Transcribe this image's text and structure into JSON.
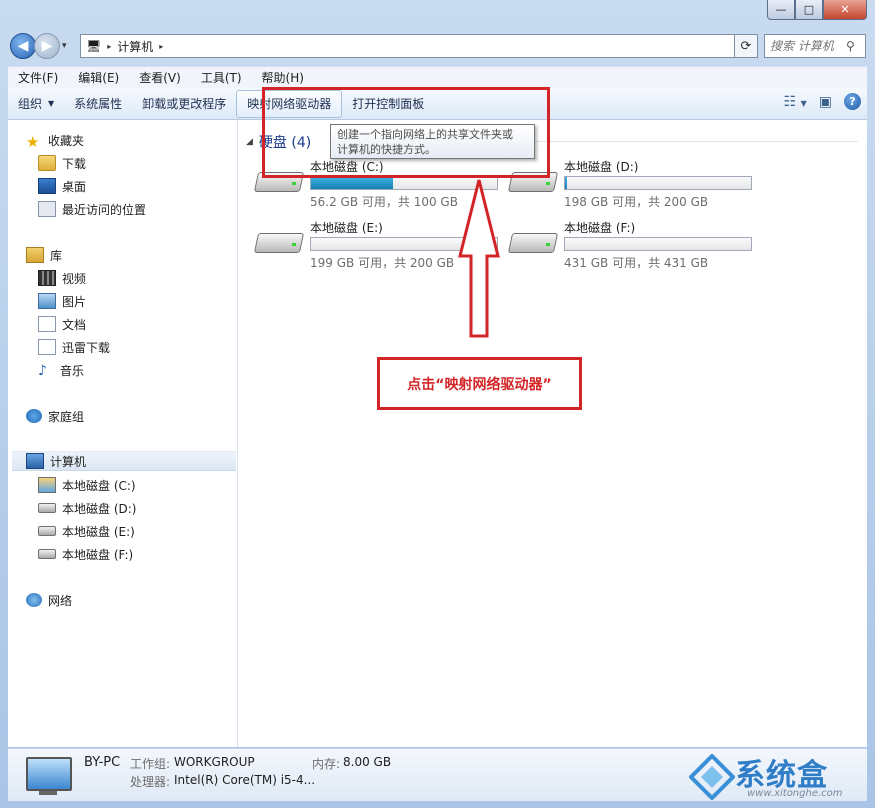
{
  "window": {
    "min_label": "—",
    "max_label": "□",
    "close_label": "✕"
  },
  "nav": {
    "back_label": "◀",
    "forward_label": "▶",
    "recent_drop": "▾"
  },
  "address": {
    "crumb": "计算机",
    "sep": "▸"
  },
  "search": {
    "placeholder": "搜索 计算机"
  },
  "menu": [
    "文件(F)",
    "编辑(E)",
    "查看(V)",
    "工具(T)",
    "帮助(H)"
  ],
  "commands": {
    "organize": "组织",
    "system_properties": "系统属性",
    "uninstall": "卸载或更改程序",
    "map_drive": "映射网络驱动器",
    "control_panel": "打开控制面板"
  },
  "tooltip": {
    "line1": "创建一个指向网络上的共享文件夹或",
    "line2": "计算机的快捷方式。"
  },
  "sidebar": {
    "favorites": "收藏夹",
    "downloads": "下载",
    "desktop": "桌面",
    "recent": "最近访问的位置",
    "libraries": "库",
    "videos": "视频",
    "pictures": "图片",
    "documents": "文档",
    "thunder": "迅雷下载",
    "music": "音乐",
    "homegroup": "家庭组",
    "computer": "计算机",
    "drive_c": "本地磁盘 (C:)",
    "drive_d": "本地磁盘 (D:)",
    "drive_e": "本地磁盘 (E:)",
    "drive_f": "本地磁盘 (F:)",
    "network": "网络"
  },
  "group": {
    "title": "硬盘 (4)"
  },
  "drives": [
    {
      "name": "本地磁盘 (C:)",
      "size": "56.2 GB 可用，共 100 GB",
      "used_fraction": 0.44
    },
    {
      "name": "本地磁盘 (D:)",
      "size": "198 GB 可用，共 200 GB",
      "used_fraction": 0.01
    },
    {
      "name": "本地磁盘 (E:)",
      "size": "199 GB 可用，共 200 GB",
      "used_fraction": 0.0
    },
    {
      "name": "本地磁盘 (F:)",
      "size": "431 GB 可用，共 431 GB",
      "used_fraction": 0.0
    }
  ],
  "status": {
    "pc_name": "BY-PC",
    "workgroup_label": "工作组:",
    "workgroup": "WORKGROUP",
    "memory_label": "内存:",
    "memory": "8.00 GB",
    "cpu_label": "处理器:",
    "cpu": "Intel(R) Core(TM) i5-4..."
  },
  "annotation": {
    "callout": "点击“映射网络驱动器”"
  },
  "watermark": {
    "name": "系统盒",
    "url": "www.xitonghe.com"
  },
  "colors": {
    "accent_red": "#d32527",
    "link_blue": "#1e3d8f",
    "bar_fill": "#1780b5"
  }
}
